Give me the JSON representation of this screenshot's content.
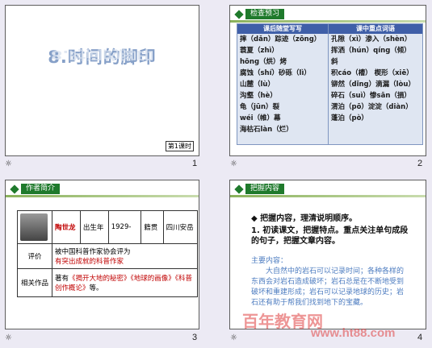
{
  "slides": [
    {
      "number": "1",
      "title": "8.时间的脚印",
      "title_reflection": "8.时间的脚印",
      "tag": "第1课时"
    },
    {
      "number": "2",
      "header": "检查预习",
      "col1_head": "课后随堂写写",
      "col2_head": "课中重点词语",
      "col1_rows": [
        "摔（dǎn）踪迹（zōng）",
        "蓑夏（zhì）",
        "hōng（烘）烤",
        "腐蚀（shí）砂砾（lì）",
        "山麓（lù）",
        "沟壑（hè）",
        "龟（jūn）裂",
        "wéi（帷）幕",
        "海枯石làn（烂）"
      ],
      "col2_rows": [
        "孔隙（xì）渗入（shèn）",
        "挥洒（hún）qíng（倾）",
        "斜",
        "积cáo（槽）  楔形（xiē）",
        "铆然（dǐng）滴漏（lòu）",
        "碎石（suì）惨sān（損）",
        "渭泊（pō）淀淀（diàn）",
        "蓬泊（pò）"
      ]
    },
    {
      "number": "3",
      "header": "作者简介",
      "name": "陶世龙",
      "born_label": "出生年",
      "born": "1929-",
      "native_label": "籍贯",
      "native": "四川安岳",
      "eval_label": "评价",
      "eval_text": "被中国科普作家协会评为",
      "eval_red": "有突出成就的科普作家",
      "works_label": "相关作品",
      "works_pre": "著有",
      "works_red": "《揭开大地的秘密》《地球的画像》《科普创作概论》",
      "works_post": "等。"
    },
    {
      "number": "4",
      "header": "把握内容",
      "point1": "◆ 把握内容，理清说明顺序。",
      "point2": "1. 初读课文，把握特点。重点关注单句成段的句子，把握文章内容。",
      "main_label": "主要内容：",
      "main_text": "大自然中的岩石可以记录时间；各种各样的东西会对岩石造成破坏；岩石总是在不断地受到破坏和重建形成；岩石可以记录地球的历史；岩石还有助于帮我们找到地下的宝藏。"
    }
  ],
  "watermark_cn": "百年教育网",
  "watermark_url": "www.ht88.com",
  "star_icon": "☼"
}
